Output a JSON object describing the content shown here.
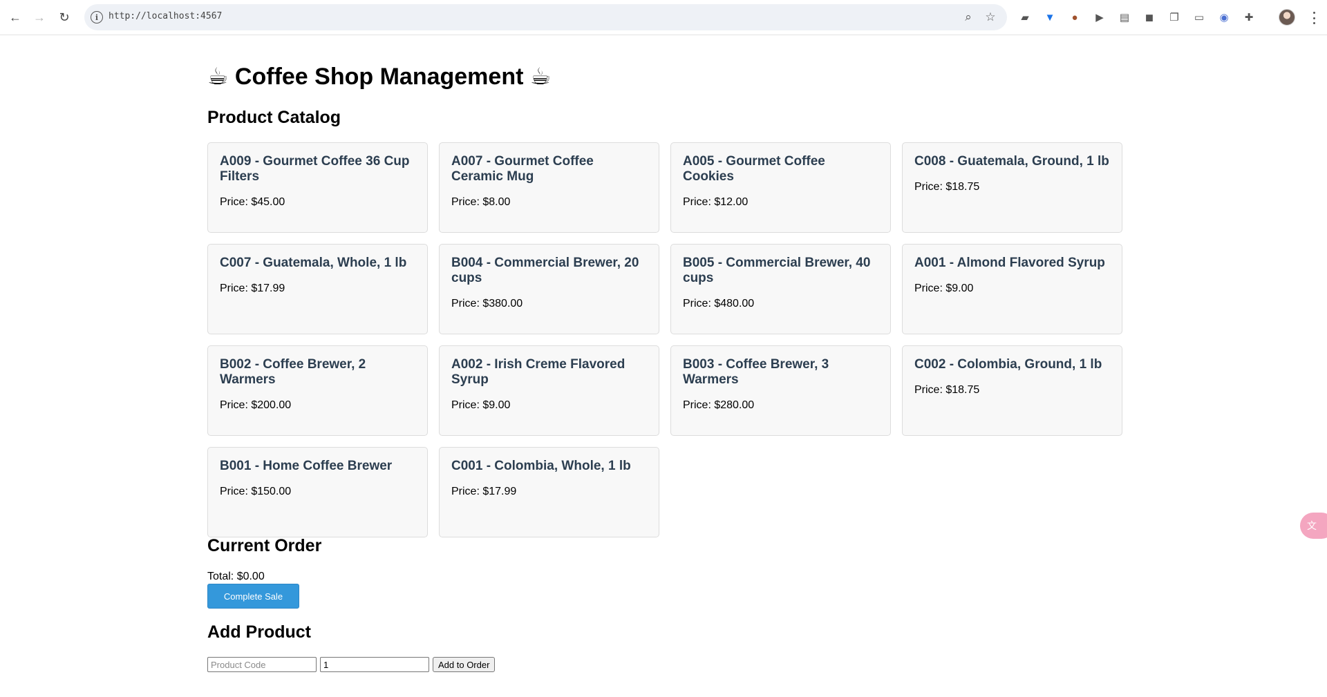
{
  "browser": {
    "url": "http://localhost:4567"
  },
  "page": {
    "title": "☕ Coffee Shop Management ☕",
    "catalog_title": "Product Catalog",
    "order_title": "Current Order",
    "order_total": "Total: $0.00",
    "complete_sale_label": "Complete Sale",
    "add_product_title": "Add Product",
    "product_code_placeholder": "Product Code",
    "quantity_value": "1",
    "add_to_order_label": "Add to Order"
  },
  "products": [
    {
      "name": "A009 - Gourmet Coffee 36 Cup Filters",
      "price": "Price: $45.00"
    },
    {
      "name": "A007 - Gourmet Coffee Ceramic Mug",
      "price": "Price: $8.00"
    },
    {
      "name": "A005 - Gourmet Coffee Cookies",
      "price": "Price: $12.00"
    },
    {
      "name": "C008 - Guatemala, Ground, 1 lb",
      "price": "Price: $18.75"
    },
    {
      "name": "C007 - Guatemala, Whole, 1 lb",
      "price": "Price: $17.99"
    },
    {
      "name": "B004 - Commercial Brewer, 20 cups",
      "price": "Price: $380.00"
    },
    {
      "name": "B005 - Commercial Brewer, 40 cups",
      "price": "Price: $480.00"
    },
    {
      "name": "A001 - Almond Flavored Syrup",
      "price": "Price: $9.00"
    },
    {
      "name": "B002 - Coffee Brewer, 2 Warmers",
      "price": "Price: $200.00"
    },
    {
      "name": "A002 - Irish Creme Flavored Syrup",
      "price": "Price: $9.00"
    },
    {
      "name": "B003 - Coffee Brewer, 3 Warmers",
      "price": "Price: $280.00"
    },
    {
      "name": "C002 - Colombia, Ground, 1 lb",
      "price": "Price: $18.75"
    },
    {
      "name": "B001 - Home Coffee Brewer",
      "price": "Price: $150.00"
    },
    {
      "name": "C001 - Colombia, Whole, 1 lb",
      "price": "Price: $17.99"
    }
  ],
  "colors": {
    "accent": "#3498db",
    "card_title": "#2c3e50"
  }
}
